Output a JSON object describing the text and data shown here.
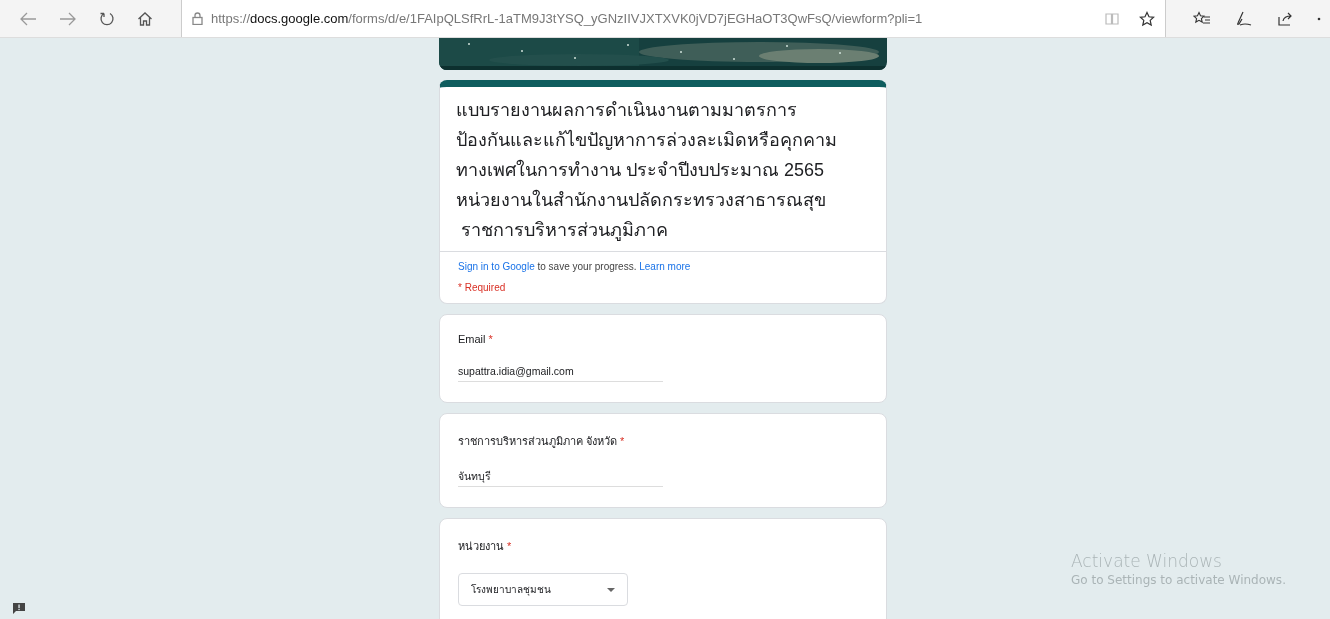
{
  "browser": {
    "url": {
      "scheme": "https://",
      "host": "docs.google.com",
      "path": "/forms/d/e/1FAIpQLSfRrL-1aTM9J3tYSQ_yGNzIIVJXTXVK0jVD7jEGHaOT3QwFsQ/viewform?pli=1"
    }
  },
  "form": {
    "title_lines": [
      "แบบรายงานผลการดำเนินงานตามมาตรการ",
      "ป้องกันและแก้ไขปัญหาการล่วงละเมิดหรือคุกคาม",
      "ทางเพศในการทำงาน ประจำปีงบประมาณ 2565",
      "หน่วยงานในสำนักงานปลัดกระทรวงสาธารณสุข",
      " ราชการบริหารส่วนภูมิภาค"
    ],
    "sign_in": {
      "link": "Sign in to Google",
      "text": " to save your progress. ",
      "learn_more": "Learn more"
    },
    "required_note": "* Required",
    "questions": [
      {
        "kind": "text",
        "label": "Email",
        "required_mark": "*",
        "value": "supattra.idia@gmail.com"
      },
      {
        "kind": "text",
        "label": "ราชการบริหารส่วนภูมิภาค จังหวัด",
        "required_mark": "*",
        "value": "จันทบุรี"
      },
      {
        "kind": "dropdown",
        "label": "หน่วยงาน",
        "required_mark": "*",
        "value": "โรงพยาบาลชุมชน"
      }
    ]
  },
  "windows_notice": {
    "title": "Activate Windows",
    "text": "Go to Settings to activate Windows."
  }
}
